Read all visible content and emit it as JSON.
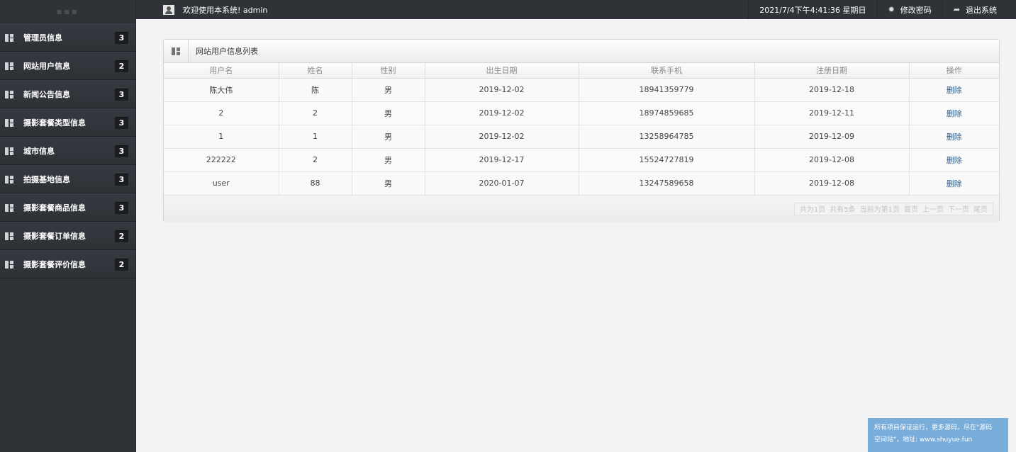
{
  "sidebar": {
    "items": [
      {
        "label": "管理员信息",
        "count": "3"
      },
      {
        "label": "网站用户信息",
        "count": "2"
      },
      {
        "label": "新闻公告信息",
        "count": "3"
      },
      {
        "label": "摄影套餐类型信息",
        "count": "3"
      },
      {
        "label": "城市信息",
        "count": "3"
      },
      {
        "label": "拍摄基地信息",
        "count": "3"
      },
      {
        "label": "摄影套餐商品信息",
        "count": "3"
      },
      {
        "label": "摄影套餐订单信息",
        "count": "2"
      },
      {
        "label": "摄影套餐评价信息",
        "count": "2"
      }
    ]
  },
  "header": {
    "welcome": "欢迎使用本系统! admin",
    "datetime": "2021/7/4下午4:41:36 星期日",
    "change_password": "修改密码",
    "logout": "退出系统"
  },
  "panel": {
    "title": "网站用户信息列表",
    "columns": [
      "用户名",
      "姓名",
      "性别",
      "出生日期",
      "联系手机",
      "注册日期",
      "操作"
    ],
    "rows": [
      [
        "陈大伟",
        "陈",
        "男",
        "2019-12-02",
        "18941359779",
        "2019-12-18",
        "删除"
      ],
      [
        "2",
        "2",
        "男",
        "2019-12-02",
        "18974859685",
        "2019-12-11",
        "删除"
      ],
      [
        "1",
        "1",
        "男",
        "2019-12-02",
        "13258964785",
        "2019-12-09",
        "删除"
      ],
      [
        "222222",
        "2",
        "男",
        "2019-12-17",
        "15524727819",
        "2019-12-08",
        "删除"
      ],
      [
        "user",
        "88",
        "男",
        "2020-01-07",
        "13247589658",
        "2019-12-08",
        "删除"
      ]
    ],
    "pager": [
      "共为1页",
      "共有5条",
      "当前为第1页",
      "首页",
      "上一页",
      "下一页",
      "尾页"
    ]
  },
  "notice": {
    "line1": "所有项目保证运行，更多源码，尽在\"源码",
    "line2": "空间站\"，地址: www.shuyue.fun"
  }
}
